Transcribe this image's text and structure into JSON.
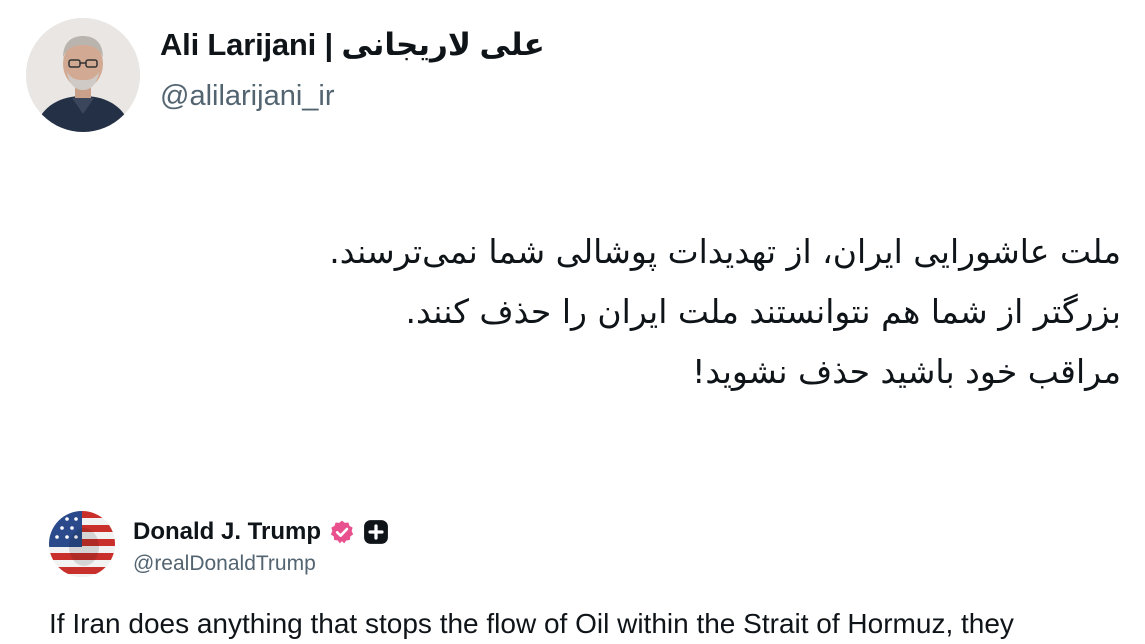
{
  "post": {
    "author_name": "Ali Larijani | علی لاریجانی",
    "author_handle": "@alilarijani_ir",
    "text_lines": [
      "ملت عاشورایی ایران، از تهدیدات پوشالی شما نمی‌ترسند.",
      "بزرگتر از شما هم نتوانستند ملت ایران را حذف کنند.",
      "مراقب خود باشید حذف نشوید!"
    ]
  },
  "quoted_post": {
    "author_name": "Donald J. Trump",
    "author_handle": "@realDonaldTrump",
    "text": "If Iran does anything that stops the flow of Oil within the Strait of Hormuz, they",
    "verified_icon": "verified-badge-icon",
    "extra_icon": "plus-badge-icon"
  },
  "colors": {
    "text": "#0f1419",
    "secondary_text": "#536471",
    "verified_badge": "#e8518e",
    "background": "#ffffff"
  }
}
